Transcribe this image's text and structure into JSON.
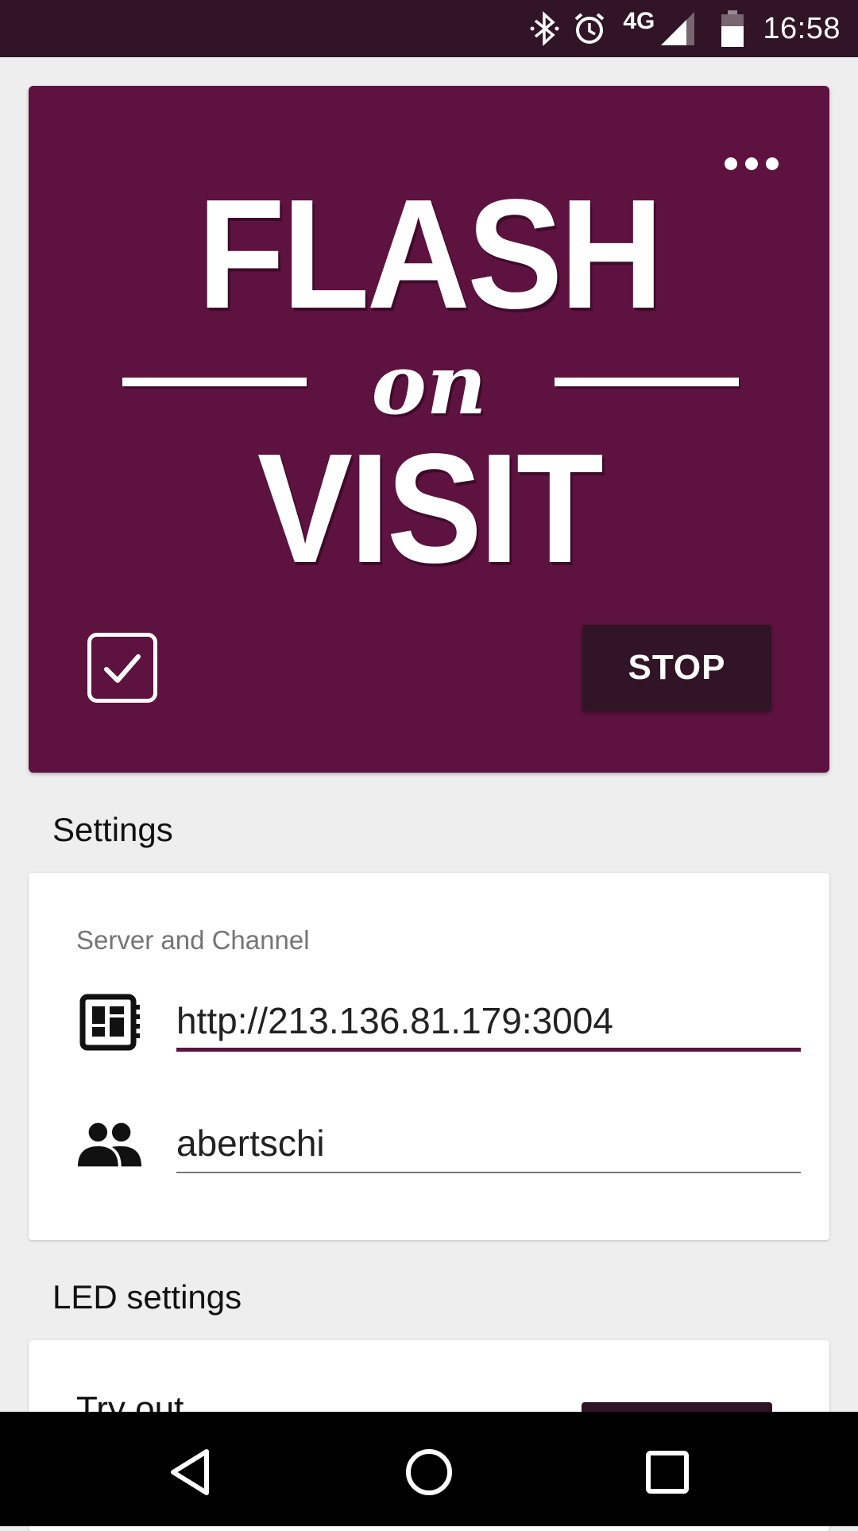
{
  "status_bar": {
    "network": "4G",
    "time": "16:58",
    "icons": [
      "bluetooth-icon",
      "alarm-icon",
      "signal-icon",
      "battery-icon"
    ]
  },
  "hero": {
    "logo_top": "FLASH",
    "logo_middle": "on",
    "logo_bottom": "VISIT",
    "checkbox_checked": true,
    "stop_label": "STOP",
    "background_color": "#5e1240",
    "button_color": "#311425"
  },
  "settings": {
    "title": "Settings",
    "subtitle": "Server and Channel",
    "server_value": "http://213.136.81.179:3004",
    "channel_value": "abertschi",
    "accent_color": "#5e1240"
  },
  "led_settings": {
    "title": "LED settings",
    "tryout_label": "Try out"
  },
  "nav": {
    "icons": [
      "back-icon",
      "home-icon",
      "recents-icon"
    ]
  }
}
